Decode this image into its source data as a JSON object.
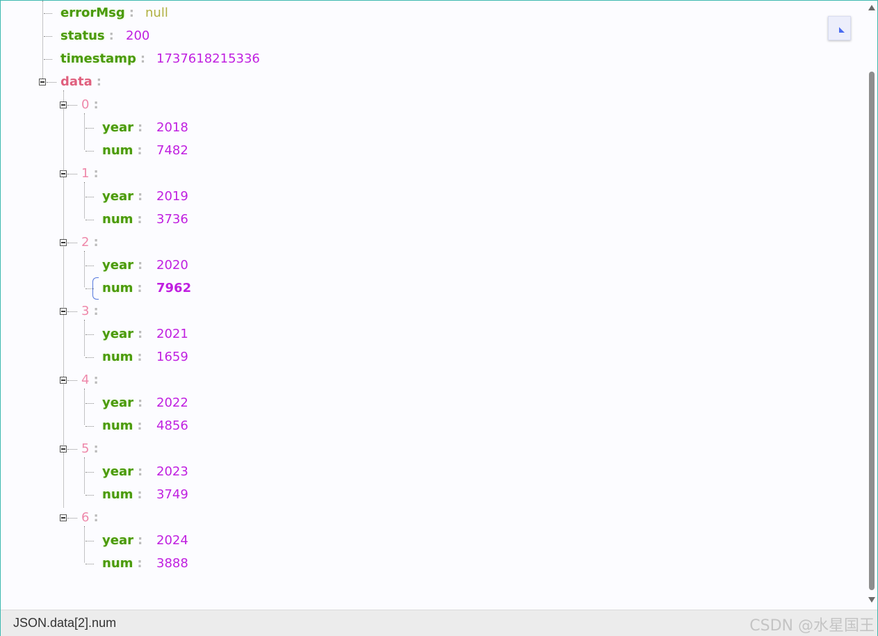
{
  "root_fields": [
    {
      "key": "errorMsg",
      "value": "null",
      "type": "null"
    },
    {
      "key": "status",
      "value": "200",
      "type": "number"
    },
    {
      "key": "timestamp",
      "value": "1737618215336",
      "type": "number"
    }
  ],
  "data_key": "data",
  "colon": ":",
  "items": [
    {
      "index": "0",
      "year_key": "year",
      "year": "2018",
      "num_key": "num",
      "num": "7482"
    },
    {
      "index": "1",
      "year_key": "year",
      "year": "2019",
      "num_key": "num",
      "num": "3736"
    },
    {
      "index": "2",
      "year_key": "year",
      "year": "2020",
      "num_key": "num",
      "num": "7962"
    },
    {
      "index": "3",
      "year_key": "year",
      "year": "2021",
      "num_key": "num",
      "num": "1659"
    },
    {
      "index": "4",
      "year_key": "year",
      "year": "2022",
      "num_key": "num",
      "num": "4856"
    },
    {
      "index": "5",
      "year_key": "year",
      "year": "2023",
      "num_key": "num",
      "num": "3749"
    },
    {
      "index": "6",
      "year_key": "year",
      "year": "2024",
      "num_key": "num",
      "num": "3888"
    }
  ],
  "selected_item": "2",
  "status_bar": {
    "path": "JSON.data[2].num",
    "watermark": "CSDN @水星国王"
  },
  "colors": {
    "key": "#4a9a0a",
    "object_key": "#e0607e",
    "index_key": "#ee88aa",
    "number": "#c020e0",
    "null": "#b0b040"
  },
  "icons": {
    "toggle": "minus-box-icon",
    "collapse": "triangle-corner-icon"
  }
}
